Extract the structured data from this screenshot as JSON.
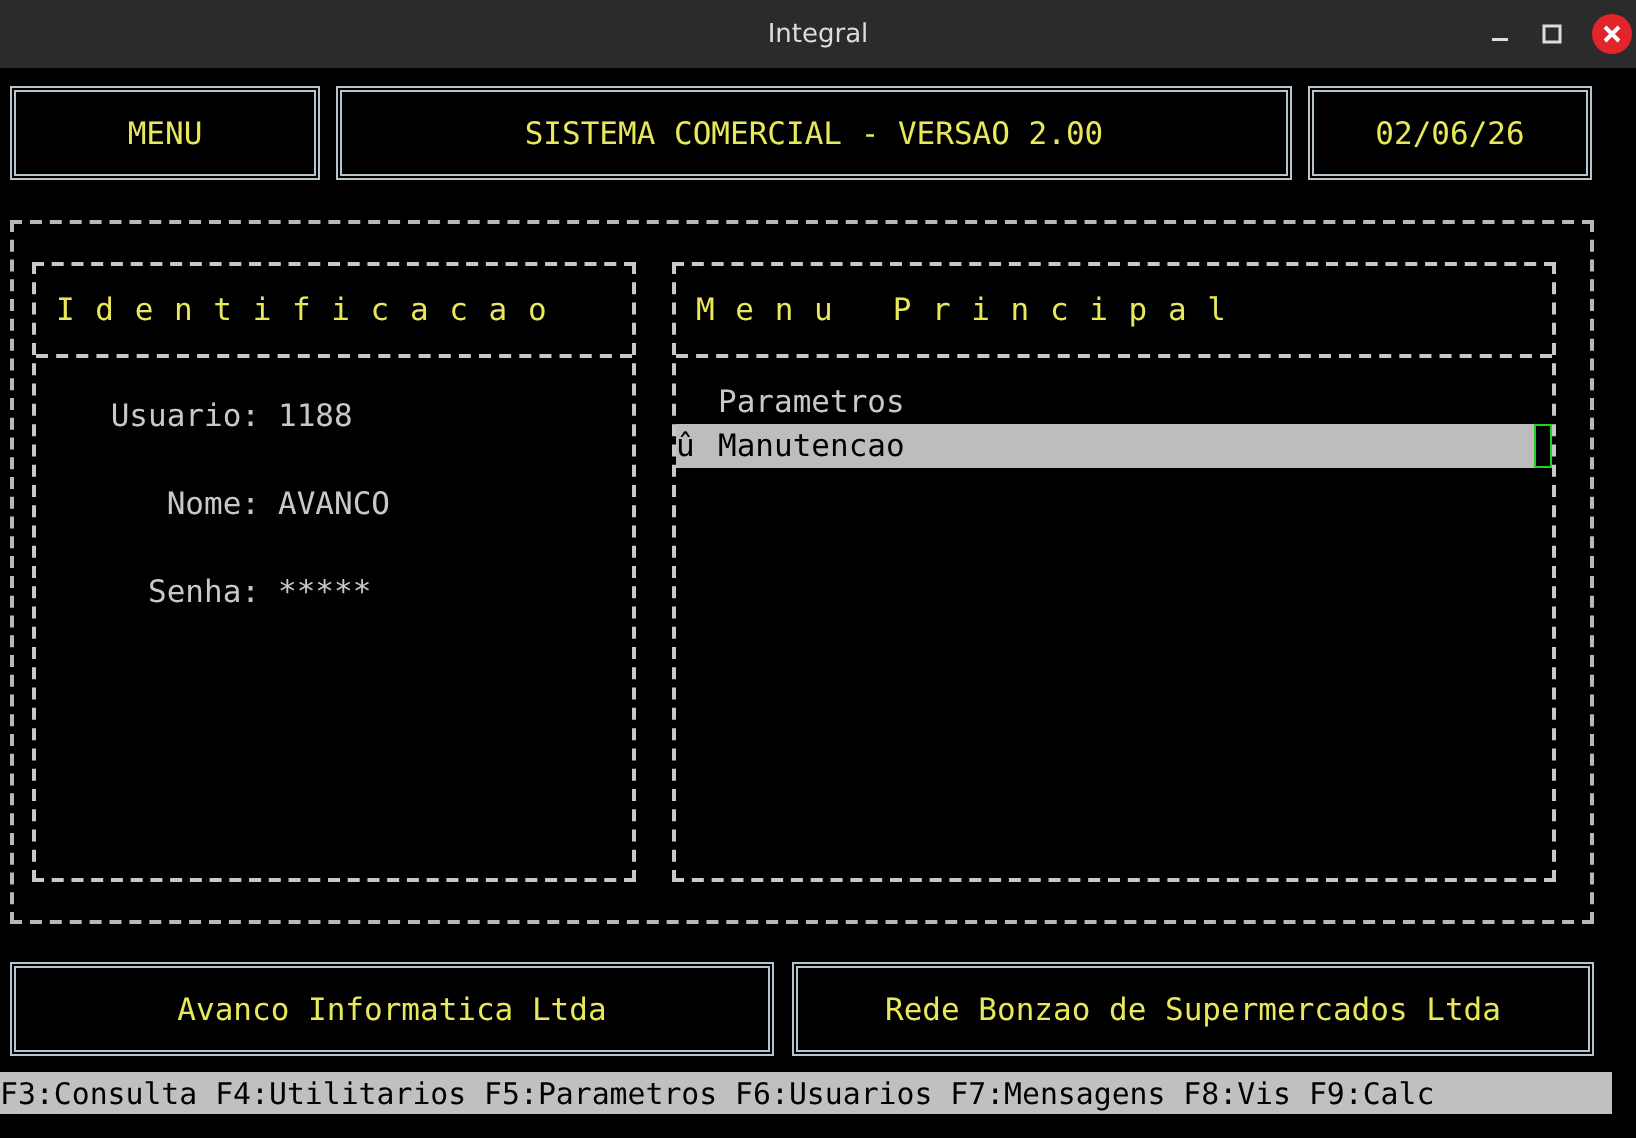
{
  "window": {
    "title": "Integral"
  },
  "header": {
    "menu": "MENU",
    "title": "SISTEMA COMERCIAL - VERSAO 2.00",
    "date": "02/06/26"
  },
  "identification": {
    "title": "I d e n t i f i c a c a o",
    "fields": [
      {
        "label": "Usuario:",
        "value": "1188"
      },
      {
        "label": "Nome:",
        "value": "AVANCO"
      },
      {
        "label": "Senha:",
        "value": "*****"
      }
    ]
  },
  "main_menu": {
    "title": "M e n u   P r i n c i p a l",
    "items": [
      {
        "marker": "",
        "label": "Parametros",
        "selected": false
      },
      {
        "marker": "û",
        "label": "Manutencao",
        "selected": true
      }
    ]
  },
  "footer": {
    "left": "Avanco Informatica Ltda",
    "right": "Rede Bonzao de Supermercados Ltda"
  },
  "status_bar": "F3:Consulta F4:Utilitarios F5:Parametros F6:Usuarios F7:Mensagens F8:Vis F9:Calc"
}
